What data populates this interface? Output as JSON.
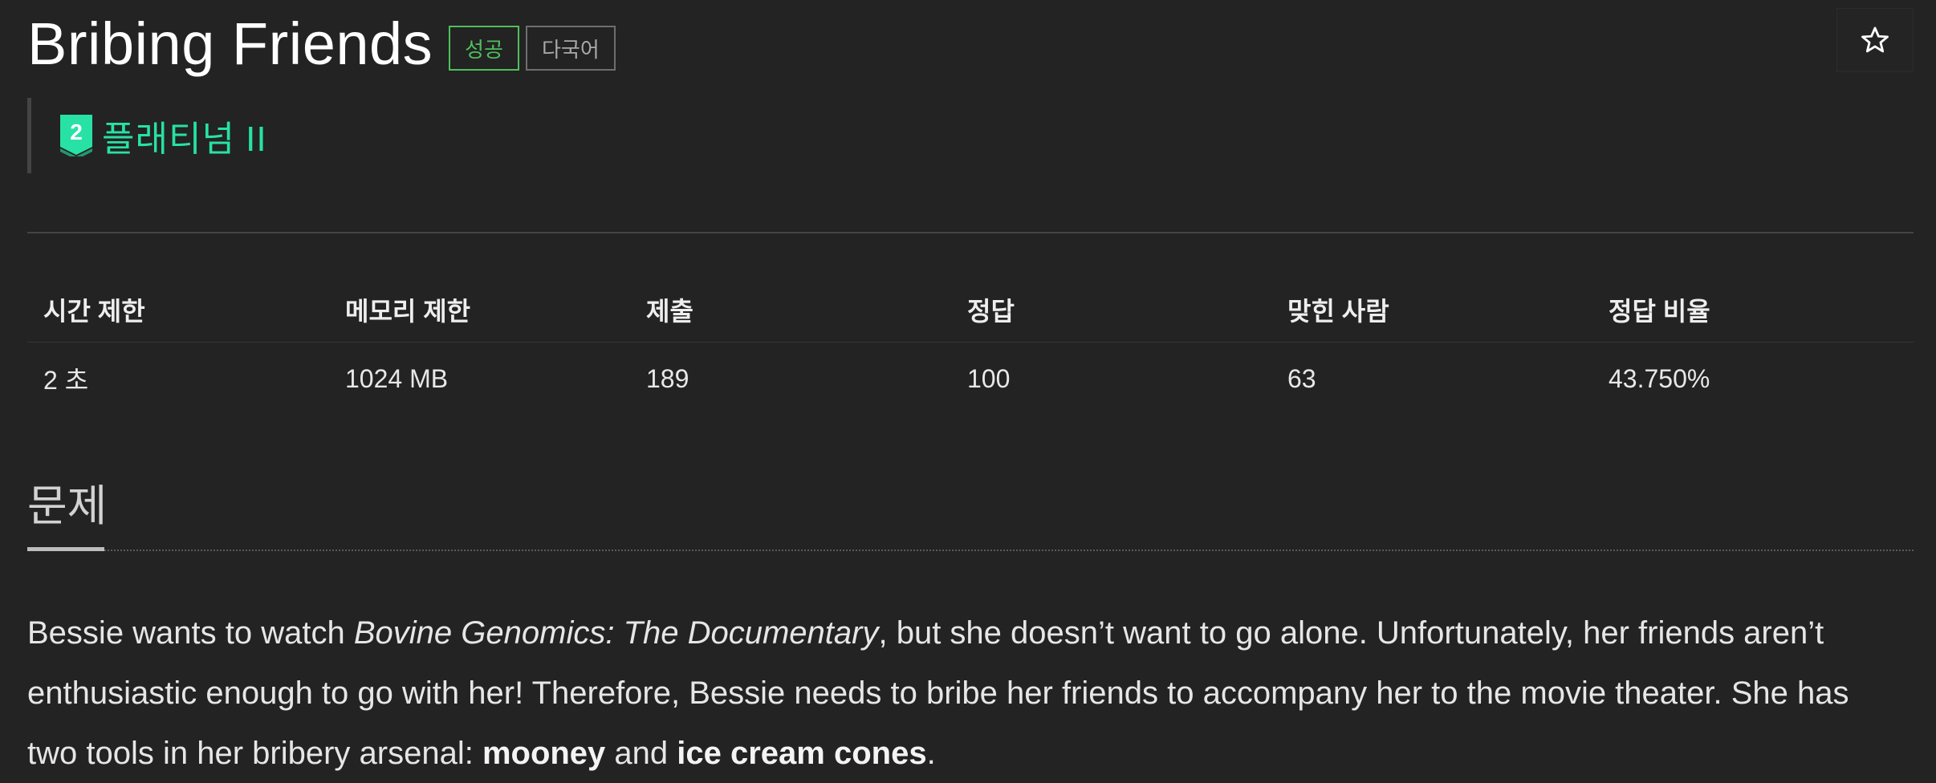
{
  "problem": {
    "title": "Bribing Friends",
    "badges": {
      "success": "성공",
      "multilang": "다국어"
    },
    "tier": {
      "level": "2",
      "label": "플래티넘 II",
      "color": "#27e2a4"
    },
    "star_icon": "star-outline-icon"
  },
  "stats": {
    "headers": [
      "시간 제한",
      "메모리 제한",
      "제출",
      "정답",
      "맞힌 사람",
      "정답 비율"
    ],
    "values": [
      "2 초",
      "1024 MB",
      "189",
      "100",
      "63",
      "43.750%"
    ]
  },
  "section": {
    "title": "문제"
  },
  "description": {
    "p1": "Bessie wants to watch ",
    "italic": "Bovine Genomics: The Documentary",
    "p2": ", but she doesn’t want to go alone. Unfortunately, her friends aren’t enthusiastic enough to go with her! Therefore, Bessie needs to bribe her friends to accompany her to the movie theater. She has two tools in her bribery arsenal: ",
    "bold1": "mooney",
    "p3": " and ",
    "bold2": "ice cream cones",
    "p4": "."
  },
  "colors": {
    "background": "#232323",
    "success": "#4fbf5b",
    "platinum": "#27e2a4"
  }
}
